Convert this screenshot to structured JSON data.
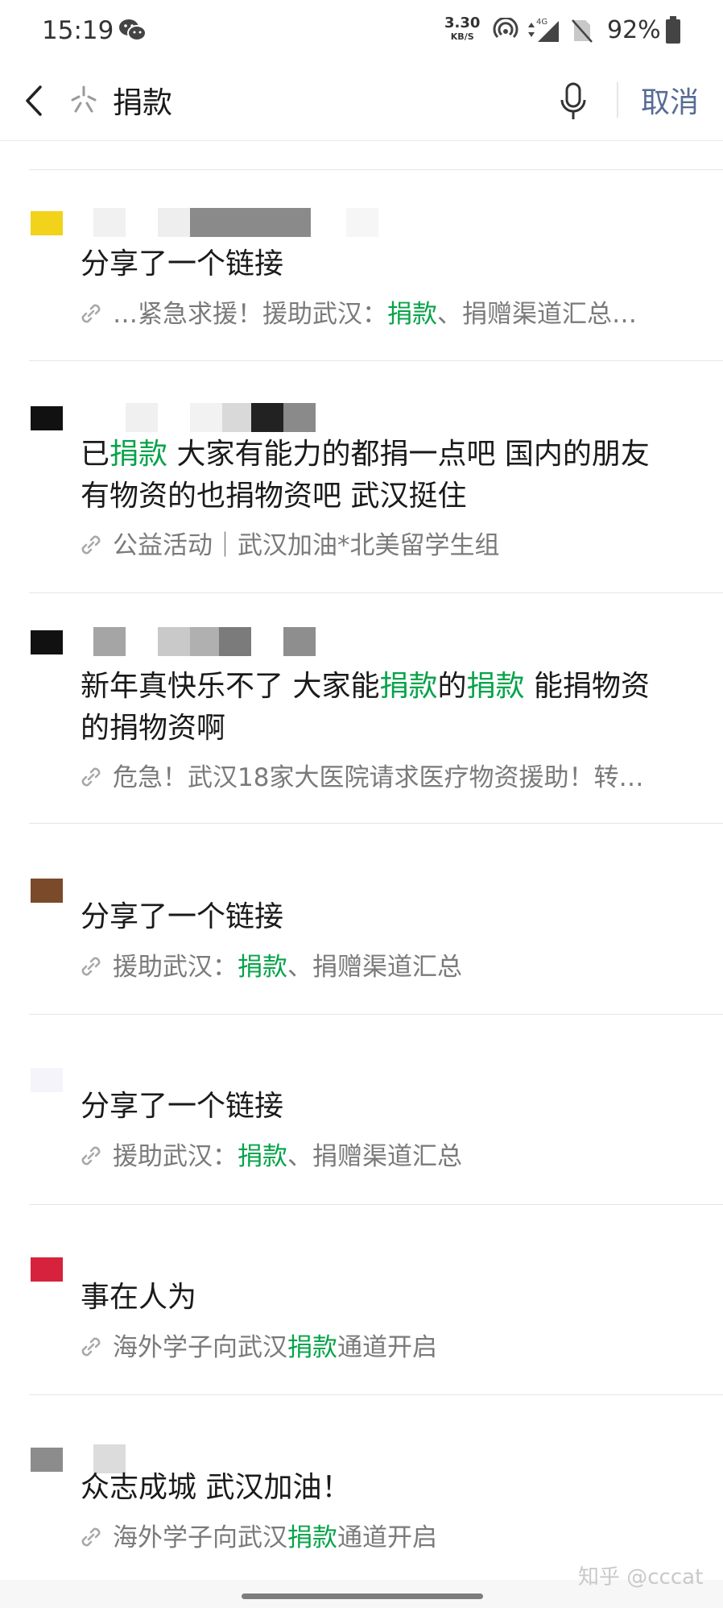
{
  "status_bar": {
    "time": "15:19",
    "speed_value": "3.30",
    "speed_unit": "KB/S",
    "network": "4G",
    "battery": "92%"
  },
  "search": {
    "query": "捐款",
    "cancel_label": "取消"
  },
  "results": [
    {
      "text_segments": [
        {
          "t": "分享了一个链接",
          "h": false
        }
      ],
      "link_segments": [
        {
          "t": "…紧急求援！援助武汉：",
          "h": false
        },
        {
          "t": "捐款",
          "h": true
        },
        {
          "t": "、捐赠渠道汇总…",
          "h": false
        }
      ]
    },
    {
      "text_line1": [
        {
          "t": "已",
          "h": false
        },
        {
          "t": "捐款",
          "h": true
        },
        {
          "t": " 大家有能力的都捐一点吧 国内的朋友",
          "h": false
        }
      ],
      "text_line2": [
        {
          "t": "有物资的也捐物资吧 武汉挺住",
          "h": false
        }
      ],
      "link_segments": [
        {
          "t": "公益活动｜武汉加油*北美留学生组",
          "h": false
        }
      ]
    },
    {
      "text_line1": [
        {
          "t": "新年真快乐不了 大家能",
          "h": false
        },
        {
          "t": "捐款",
          "h": true
        },
        {
          "t": "的",
          "h": false
        },
        {
          "t": "捐款",
          "h": true
        },
        {
          "t": " 能捐物资",
          "h": false
        }
      ],
      "text_line2": [
        {
          "t": "的捐物资啊",
          "h": false
        }
      ],
      "link_segments": [
        {
          "t": "危急！武汉18家大医院请求医疗物资援助！转…",
          "h": false
        }
      ]
    },
    {
      "text_segments": [
        {
          "t": "分享了一个链接",
          "h": false
        }
      ],
      "link_segments": [
        {
          "t": "援助武汉：",
          "h": false
        },
        {
          "t": "捐款",
          "h": true
        },
        {
          "t": "、捐赠渠道汇总",
          "h": false
        }
      ]
    },
    {
      "text_segments": [
        {
          "t": "分享了一个链接",
          "h": false
        }
      ],
      "link_segments": [
        {
          "t": "援助武汉：",
          "h": false
        },
        {
          "t": "捐款",
          "h": true
        },
        {
          "t": "、捐赠渠道汇总",
          "h": false
        }
      ]
    },
    {
      "text_segments": [
        {
          "t": "事在人为",
          "h": false
        }
      ],
      "link_segments": [
        {
          "t": "海外学子向武汉",
          "h": false
        },
        {
          "t": "捐款",
          "h": true
        },
        {
          "t": "通道开启",
          "h": false
        }
      ]
    },
    {
      "text_segments": [
        {
          "t": "众志成城 武汉加油！",
          "h": false
        }
      ],
      "link_segments": [
        {
          "t": "海外学子向武汉",
          "h": false
        },
        {
          "t": "捐款",
          "h": true
        },
        {
          "t": "通道开启",
          "h": false
        }
      ]
    }
  ],
  "watermark": "知乎 @cccat",
  "colors": {
    "highlight": "#07a34a",
    "cancel": "#576b95",
    "secondary_text": "#7a7a7a",
    "avatars": [
      "#f2d21b",
      "#111111",
      "#111111",
      "#7a4a2a",
      "#f4f4fa",
      "#d6223c",
      "#8c8c8c"
    ]
  },
  "icons": [
    "wechat-icon",
    "hotspot-icon",
    "signal-icon",
    "no-sim-icon",
    "battery-icon",
    "back-icon",
    "spark-icon",
    "mic-icon",
    "link-icon"
  ]
}
